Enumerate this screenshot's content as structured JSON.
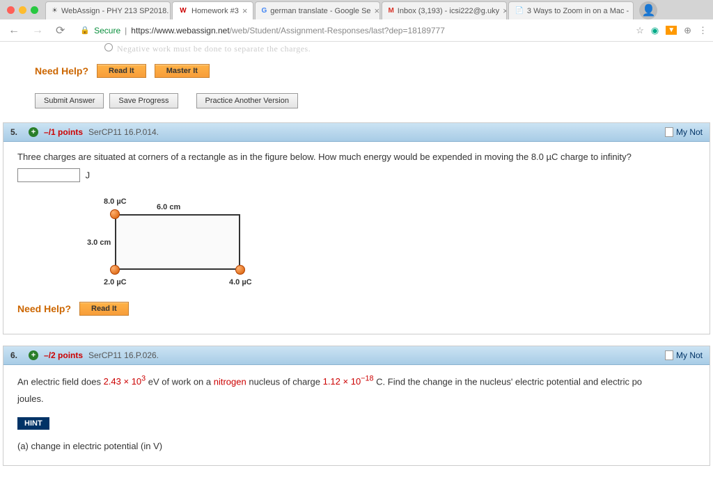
{
  "chrome": {
    "tabs": [
      {
        "label": "WebAssign - PHY 213 SP2018."
      },
      {
        "label": "Homework #3"
      },
      {
        "label": "german translate - Google Se"
      },
      {
        "label": "Inbox (3,193) - icsi222@g.uky"
      },
      {
        "label": "3 Ways to Zoom in on a Mac -"
      }
    ],
    "secure": "Secure",
    "url_host": "https://www.webassign.net",
    "url_path": "/web/Student/Assignment-Responses/last?dep=18189777"
  },
  "truncated": "Negative work must be done to separate the charges.",
  "help": {
    "label": "Need Help?",
    "read": "Read It",
    "master": "Master It"
  },
  "actions": {
    "submit": "Submit Answer",
    "save": "Save Progress",
    "practice": "Practice Another Version"
  },
  "q5": {
    "num": "5.",
    "points": "–/1 points",
    "ref": "SerCP11 16.P.014.",
    "notes": "My Not",
    "text": "Three charges are situated at corners of a rectangle as in the figure below. How much energy would be expended in moving the 8.0 µC charge to infinity?",
    "unit": "J",
    "fig": {
      "q1": "8.0 µC",
      "q2": "2.0 µC",
      "q3": "4.0 µC",
      "w": "6.0 cm",
      "h": "3.0 cm"
    }
  },
  "q6": {
    "num": "6.",
    "points": "–/2 points",
    "ref": "SerCP11 16.P.026.",
    "notes": "My Not",
    "text_a": "An electric field does ",
    "val1": "2.43 × 10",
    "exp1": "3",
    "text_b": " eV of work on a ",
    "nitrogen": "nitrogen",
    "text_c": " nucleus of charge ",
    "val2": "1.12 × 10",
    "exp2": "−18",
    "text_d": " C. Find the change in the nucleus' electric potential and electric po",
    "joules": "joules.",
    "hint": "HINT",
    "part_a": "(a)   change in electric potential (in V)"
  }
}
